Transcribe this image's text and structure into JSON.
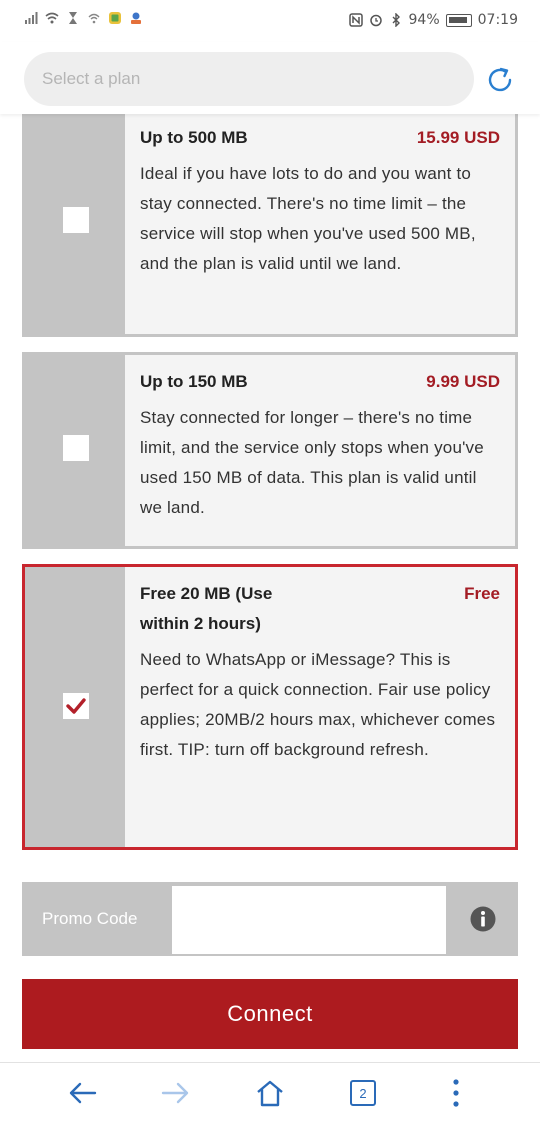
{
  "status_bar": {
    "battery": "94%",
    "time": "07:19"
  },
  "header": {
    "search_placeholder": "Select a plan"
  },
  "plans": [
    {
      "title": "Up to 500 MB",
      "price": "15.99 USD",
      "description": "Ideal if you have lots to do and you want to stay connected. There's no time limit – the service will stop when you've used 500 MB, and the plan is valid until we land.",
      "selected": false
    },
    {
      "title": "Up to 150 MB",
      "price": "9.99 USD",
      "description": "Stay connected for longer – there's no time limit, and the service only stops when you've used 150 MB of data. This plan is valid until we land.",
      "selected": false
    },
    {
      "title": "Free 20 MB (Use within 2 hours)",
      "price": "Free",
      "description": "Need to WhatsApp or iMessage? This is perfect for a quick connection. Fair use policy applies; 20MB/2 hours max, whichever comes first. TIP: turn off background refresh.",
      "selected": true
    }
  ],
  "promo": {
    "label": "Promo Code",
    "value": ""
  },
  "connect_label": "Connect",
  "navbar": {
    "tab_count": "2"
  },
  "colors": {
    "accent": "#ad1b1f",
    "price": "#a31c24",
    "selected_border": "#c8262e",
    "panel_gray": "#c4c4c4",
    "nav_blue": "#2a6ab8"
  }
}
